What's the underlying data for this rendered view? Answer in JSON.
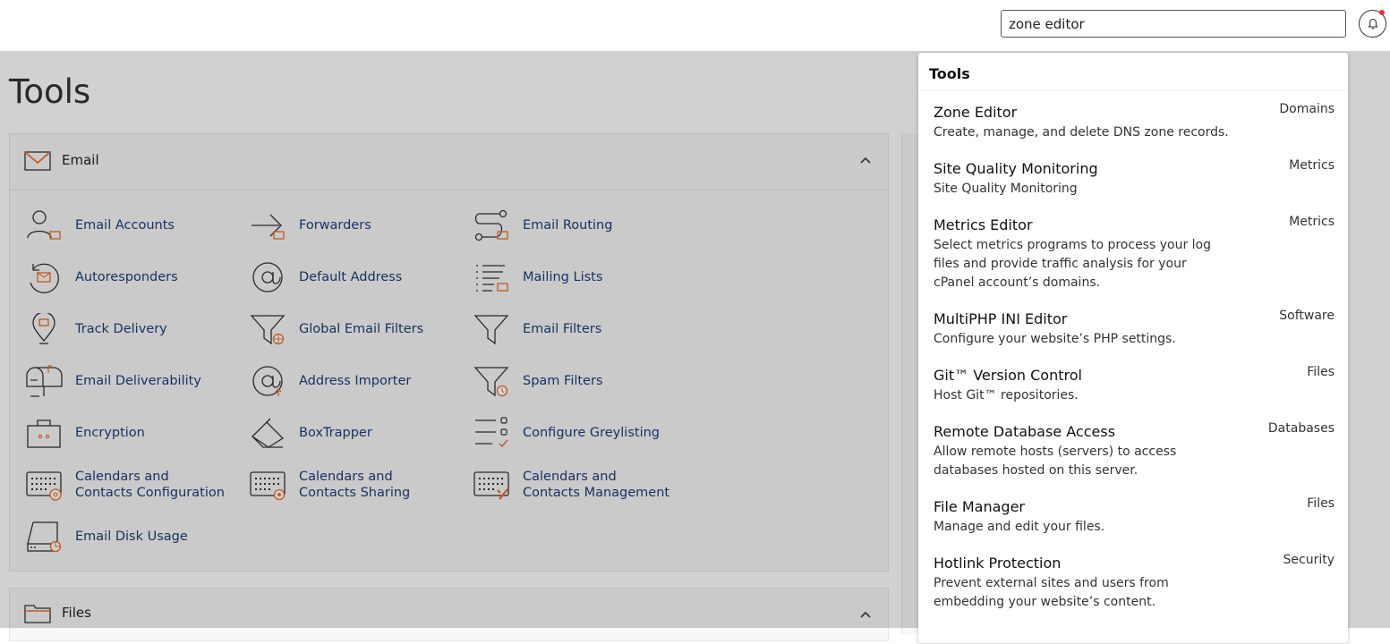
{
  "search": {
    "value": "zone editor"
  },
  "page": {
    "title": "Tools"
  },
  "email_section": {
    "title": "Email",
    "tools": [
      "Email Accounts",
      "Forwarders",
      "Email Routing",
      "Autoresponders",
      "Default Address",
      "Mailing Lists",
      "Track Delivery",
      "Global Email Filters",
      "Email Filters",
      "Email Deliverability",
      "Address Importer",
      "Spam Filters",
      "Encryption",
      "BoxTrapper",
      "Configure Greylisting",
      "Calendars and Contacts Configuration",
      "Calendars and Contacts Sharing",
      "Calendars and Contacts Management",
      "Email Disk Usage"
    ]
  },
  "files_section": {
    "title": "Files"
  },
  "results": {
    "heading": "Tools",
    "items": [
      {
        "name": "Zone Editor",
        "desc": "Create, manage, and delete DNS zone records.",
        "category": "Domains"
      },
      {
        "name": "Site Quality Monitoring",
        "desc": "Site Quality Monitoring",
        "category": "Metrics"
      },
      {
        "name": "Metrics Editor",
        "desc": "Select metrics programs to process your log files and provide traffic analysis for your cPanel account’s domains.",
        "category": "Metrics"
      },
      {
        "name": "MultiPHP INI Editor",
        "desc": "Configure your website’s PHP settings.",
        "category": "Software"
      },
      {
        "name": "Git™ Version Control",
        "desc": "Host Git™ repositories.",
        "category": "Files"
      },
      {
        "name": "Remote Database Access",
        "desc": "Allow remote hosts (servers) to access databases hosted on this server.",
        "category": "Databases"
      },
      {
        "name": "File Manager",
        "desc": "Manage and edit your files.",
        "category": "Files"
      },
      {
        "name": "Hotlink Protection",
        "desc": "Prevent external sites and users from embedding your website’s content.",
        "category": "Security"
      }
    ]
  },
  "colors": {
    "accent": "#e8702a",
    "link": "#1d3d78",
    "notification": "#e5312f"
  }
}
